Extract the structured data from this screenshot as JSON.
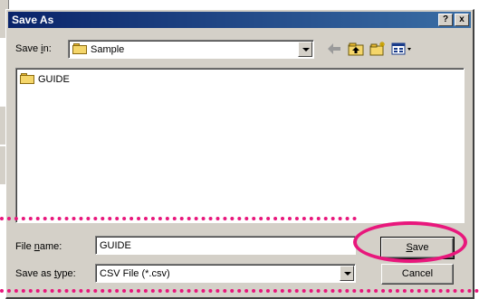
{
  "window": {
    "title": "Save As",
    "help_label": "?",
    "close_label": "x"
  },
  "location": {
    "label_prefix": "Save ",
    "label_mnemonic": "i",
    "label_suffix": "n:",
    "folder_name": "Sample"
  },
  "files": [
    {
      "name": "GUIDE",
      "type": "folder"
    }
  ],
  "file_name": {
    "label_prefix": "File ",
    "label_mnemonic": "n",
    "label_suffix": "ame:",
    "value": "GUIDE"
  },
  "save_as_type": {
    "label_prefix": "Save as ",
    "label_mnemonic": "t",
    "label_suffix": "ype:",
    "value": "CSV File (*.csv)"
  },
  "buttons": {
    "save_mnemonic": "S",
    "save_rest": "ave",
    "cancel": "Cancel"
  },
  "colors": {
    "highlight": "#e8177c",
    "dialog_face": "#d4d0c8",
    "titlebar": "#0a246a"
  }
}
